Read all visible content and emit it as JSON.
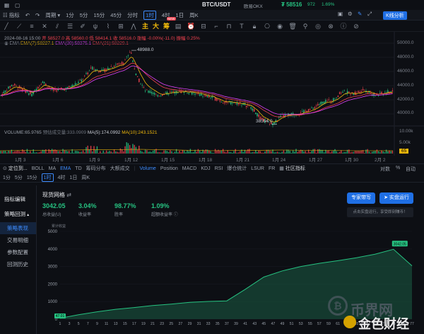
{
  "topbar": {
    "indicator_label": "指标",
    "period_label": "周期",
    "intervals": [
      "1分",
      "5分",
      "15分",
      "45分",
      "分时",
      "1时",
      "4时",
      "1日",
      "周K"
    ],
    "active_interval": "1时",
    "pair": "BTC/USDT",
    "exchange": "欧易OKX",
    "price": "₮ 58516",
    "change_abs": "972",
    "change_pct": "1.69%",
    "kline_btn": "K线分析"
  },
  "infobar": {
    "datetime": "2024-08-16 15:00",
    "open": "开 58527.0",
    "high": "高 58560.0",
    "low": "低 58414.1",
    "close": "收 58516.0",
    "change": "涨幅 -0.00%(-11.0)",
    "amplitude": "振幅 0.25%",
    "ema_label": "EMA",
    "ema7": "EMA(7):58227.1",
    "ema30": "EMA(30):58375.1",
    "ema21": "EMA(21):58229.1"
  },
  "drawbar": {
    "cn_labels": [
      "主",
      "大",
      "筹"
    ],
    "hot_badge": "NEW"
  },
  "chart": {
    "price_ticks": [
      "50000.0",
      "48000.0",
      "46000.0",
      "44000.0",
      "42000.0",
      "40000.0"
    ],
    "annot_high": "48988.0",
    "annot_low": "38554.0",
    "volume_label": "VOLUME",
    "volume_value": "VOLUME:65.9765",
    "vol_extra": "预估成交量:333.0909",
    "ma5": "MA(5):174.0992",
    "ma10": "MA(10):243.1521",
    "vol_ticks": [
      "10.00k",
      "5.00k"
    ],
    "vol_tag": "65",
    "date_ticks": [
      "1月 3",
      "1月 6",
      "1月 9",
      "1月 12",
      "1月 15",
      "1月 18",
      "1月 21",
      "1月 24",
      "1月 27",
      "1月 30",
      "2月 2"
    ],
    "colors": {
      "up": "#26c281",
      "down": "#f0424f",
      "ema7": "#f0b90b",
      "ema30": "#e040fb",
      "ema21": "#f0424f",
      "vol": "#f0b90b"
    }
  },
  "indbar": {
    "locate": "定位到...",
    "items": [
      "BOLL",
      "MA",
      "EMA",
      "TD",
      "筹码分布",
      "大额成交",
      "Volume",
      "Position",
      "MACD",
      "KDJ",
      "RSI",
      "爆仓统计",
      "LSUR",
      "FR"
    ],
    "active": [
      "EMA",
      "Volume"
    ],
    "community": "社区指标",
    "right": [
      "对数",
      "%",
      "自动"
    ]
  },
  "timebar": {
    "items": [
      "1分",
      "5分",
      "15分",
      "1时",
      "4时",
      "1日",
      "周K"
    ],
    "active": "1时"
  },
  "sidebar": {
    "edit": "指标编辑",
    "backtest": "策略回测",
    "items": [
      "策略表现",
      "交易明细",
      "参数配置",
      "回测历史"
    ],
    "active": "策略表现"
  },
  "strategy": {
    "title": "现货网格",
    "stats": [
      {
        "value": "3042.05",
        "label": "总收益(U)"
      },
      {
        "value": "3.04%",
        "label": "收益率"
      },
      {
        "value": "98.77%",
        "label": "胜率"
      },
      {
        "value": "1.09%",
        "label": "超额收益率"
      }
    ],
    "btn_expert": "专家带写",
    "btn_live": "实盘运行",
    "live_hint": "点击实盘运行，享受即刻赚币！",
    "y_ticks": [
      "5000",
      "4000",
      "3000",
      "2000",
      "1000",
      "0"
    ],
    "y_title": "累计收益",
    "end_tag": "3042.05",
    "start_tag": "47.01",
    "x_ticks": [
      "1",
      "3",
      "5",
      "7",
      "9",
      "11",
      "13",
      "15",
      "17",
      "19",
      "21",
      "23",
      "25",
      "27",
      "29",
      "31",
      "33",
      "35",
      "37",
      "39",
      "41",
      "43",
      "45",
      "47",
      "49",
      "51",
      "53",
      "55",
      "57",
      "59",
      "61",
      "63",
      "65",
      "67",
      "69",
      "71",
      "73",
      "75",
      "77"
    ]
  },
  "watermark": {
    "brand1": "币界网",
    "brand2": "金色财经"
  },
  "chart_data": {
    "type": "area",
    "x": [
      1,
      5,
      9,
      13,
      17,
      21,
      25,
      29,
      33,
      37,
      41,
      45,
      49,
      53,
      57,
      61,
      65,
      69,
      73,
      77
    ],
    "values": [
      47,
      250,
      420,
      560,
      660,
      780,
      860,
      960,
      1010,
      1040,
      1700,
      2400,
      2750,
      3000,
      3180,
      3330,
      3500,
      3700,
      3980,
      3042
    ],
    "ylim": [
      0,
      5000
    ],
    "ylabel": "累计收益"
  }
}
